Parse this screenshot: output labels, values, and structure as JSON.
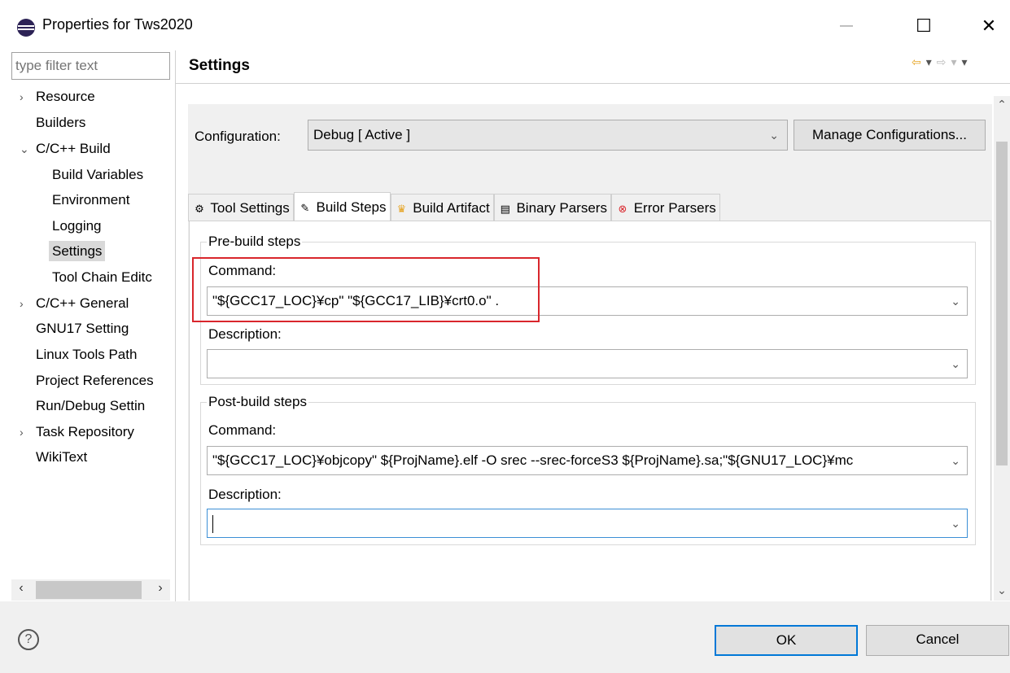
{
  "window": {
    "title": "Properties for Tws2020",
    "min_glyph": "—",
    "max_glyph": "☐",
    "close_glyph": "✕"
  },
  "sidebar": {
    "filter_placeholder": "type filter text",
    "items": [
      {
        "label": "Resource",
        "arrow": "›",
        "indent": 0
      },
      {
        "label": "Builders",
        "arrow": "",
        "indent": 0
      },
      {
        "label": "C/C++ Build",
        "arrow": "⌄",
        "indent": 0
      },
      {
        "label": "Build Variables",
        "arrow": "",
        "indent": 1
      },
      {
        "label": "Environment",
        "arrow": "",
        "indent": 1
      },
      {
        "label": "Logging",
        "arrow": "",
        "indent": 1
      },
      {
        "label": "Settings",
        "arrow": "",
        "indent": 1
      },
      {
        "label": "Tool Chain Editc",
        "arrow": "",
        "indent": 1
      },
      {
        "label": "C/C++ General",
        "arrow": "›",
        "indent": 0
      },
      {
        "label": "GNU17 Setting",
        "arrow": "",
        "indent": 0
      },
      {
        "label": "Linux Tools Path",
        "arrow": "",
        "indent": 0
      },
      {
        "label": "Project References",
        "arrow": "",
        "indent": 0
      },
      {
        "label": "Run/Debug Settin",
        "arrow": "",
        "indent": 0
      },
      {
        "label": "Task Repository",
        "arrow": "›",
        "indent": 0
      },
      {
        "label": "WikiText",
        "arrow": "",
        "indent": 0
      }
    ],
    "scroll_left": "‹",
    "scroll_right": "›"
  },
  "main": {
    "title": "Settings",
    "history": {
      "back": "⇦",
      "back_menu": "▾",
      "fwd": "⇨",
      "fwd_menu": "▾",
      "menu": "▾"
    },
    "configuration_label": "Configuration:",
    "configuration_value": "Debug  [ Active ]",
    "manage_button": "Manage Configurations...",
    "tabs": [
      {
        "label": "Tool Settings",
        "icon": "⚙"
      },
      {
        "label": "Build Steps",
        "icon": "✎"
      },
      {
        "label": "Build Artifact",
        "icon": "♛"
      },
      {
        "label": "Binary Parsers",
        "icon": "▤"
      },
      {
        "label": "Error Parsers",
        "icon": "⊗"
      }
    ],
    "pre_build": {
      "legend": "Pre-build steps",
      "command_label": "Command:",
      "command_value": "\"${GCC17_LOC}¥cp\" \"${GCC17_LIB}¥crt0.o\" .",
      "description_label": "Description:",
      "description_value": ""
    },
    "post_build": {
      "legend": "Post-build steps",
      "command_label": "Command:",
      "command_value": "\"${GCC17_LOC}¥objcopy\" ${ProjName}.elf -O srec --srec-forceS3 ${ProjName}.sa;\"${GNU17_LOC}¥mc",
      "description_label": "Description:",
      "description_value": ""
    }
  },
  "footer": {
    "help": "?",
    "ok": "OK",
    "cancel": "Cancel"
  },
  "colors": {
    "highlight": "#d9262c",
    "focus": "#0078d7"
  }
}
